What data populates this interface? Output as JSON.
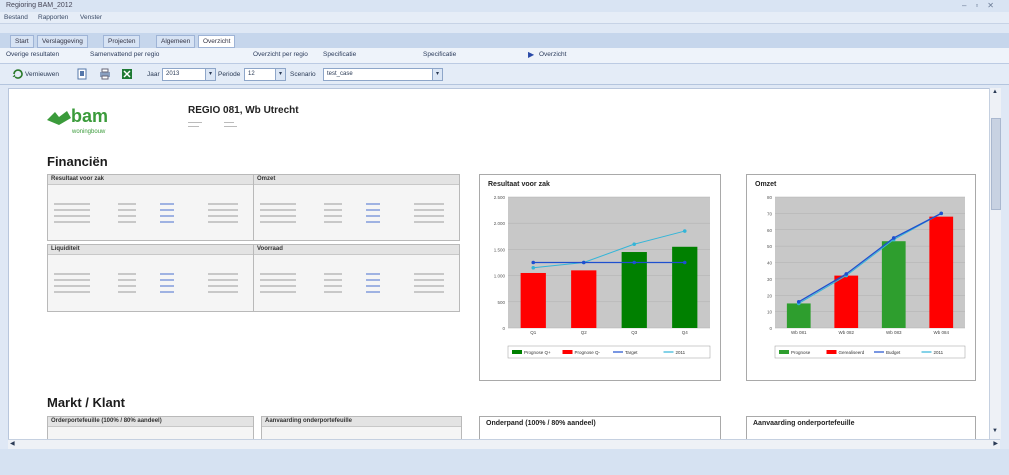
{
  "window": {
    "title": "Regioring BAM_2012"
  },
  "menu": [
    "Bestand",
    "Rapporten",
    "Venster"
  ],
  "tabs": [
    "Start",
    "Verslaggeving",
    "Projecten",
    "Algemeen",
    "Overzicht"
  ],
  "subtabs": [
    "Overige resultaten",
    "Samenvattend per regio",
    "Overzicht per regio",
    "Specificatie",
    "Specificatie",
    "Overzicht"
  ],
  "toolbar": {
    "refresh_label": "Vernieuwen",
    "jaar_label": "Jaar",
    "jaar_value": "2013",
    "periode_label": "Periode",
    "periode_value": "12",
    "scenario_label": "Scenario",
    "scenario_value": "test_case"
  },
  "report": {
    "logo": {
      "brand": "bam",
      "sub": "woningbouw"
    },
    "heading": "REGIO 081, Wb Utrecht",
    "section_financien": "Financiën",
    "section_markt": "Markt / Klant",
    "tables": [
      {
        "title": "Resultaat voor zak"
      },
      {
        "title": "Omzet"
      },
      {
        "title": "Liquiditeit"
      },
      {
        "title": "Voorraad"
      }
    ],
    "bottom_panels": [
      {
        "title": "Orderportefeuille (100% / 80% aandeel)"
      },
      {
        "title": "Aanvaarding onderportefeuille"
      },
      {
        "title": "Onderpand (100% / 80% aandeel)"
      },
      {
        "title": "Aanvaarding onderportefeuille"
      }
    ]
  },
  "chart_data": [
    {
      "type": "bar",
      "title": "Resultaat voor zak",
      "categories": [
        "Q1",
        "Q2",
        "Q3",
        "Q4"
      ],
      "ylim": [
        0,
        2500
      ],
      "yticks": [
        "0",
        "500",
        "1.000",
        "1.500",
        "2.000",
        "2.500"
      ],
      "bar_colors": [
        "#ff0000",
        "#ff0000",
        "#008000",
        "#008000"
      ],
      "values": [
        1050,
        1100,
        1450,
        1550
      ],
      "line_values": [
        1250,
        1250,
        1250,
        1250
      ],
      "trend_values": [
        1150,
        1250,
        1600,
        1850
      ],
      "legend": [
        "Prognose Q+",
        "Prognose Q-",
        "Target",
        "2011"
      ],
      "legend_colors": [
        "#008000",
        "#ff0000",
        "#1f4fcf",
        "#33b5d8"
      ]
    },
    {
      "type": "bar",
      "title": "Omzet",
      "categories": [
        "Wb 081",
        "Wb 082",
        "Wb 083",
        "Wb 084"
      ],
      "ylim": [
        0,
        80
      ],
      "yticks": [
        "0",
        "10",
        "20",
        "30",
        "40",
        "50",
        "60",
        "70",
        "80"
      ],
      "bar_colors": [
        "#2e9e2e",
        "#ff0000",
        "#2e9e2e",
        "#ff0000"
      ],
      "values": [
        15,
        32,
        53,
        68
      ],
      "line_values": [
        16,
        33,
        55,
        70
      ],
      "trend_values": [
        15,
        32,
        54,
        70
      ],
      "legend": [
        "Prognose",
        "Gerealiseerd",
        "Budget",
        "2011"
      ],
      "legend_colors": [
        "#2e9e2e",
        "#ff0000",
        "#1f4fcf",
        "#33b5d8"
      ]
    }
  ]
}
